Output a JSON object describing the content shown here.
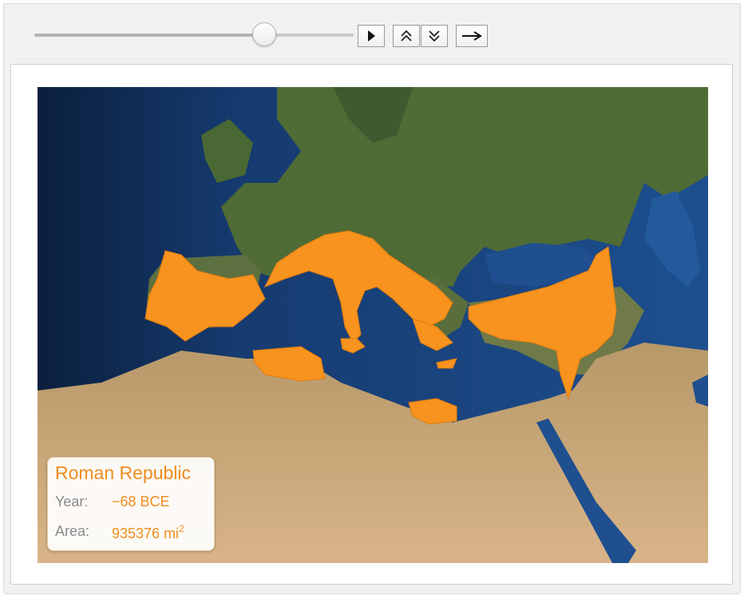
{
  "controls": {
    "slider_value": 0.72,
    "play_icon": "play-icon",
    "faster_icon": "double-chevron-up-icon",
    "slower_icon": "double-chevron-down-icon",
    "direction_icon": "arrow-right-icon"
  },
  "map": {
    "empire_color": "#f7931e",
    "sea_color": "#1f4f8c",
    "land_color": "#4d6b34",
    "desert_color": "#c9a06a"
  },
  "info": {
    "title": "Roman Republic",
    "year_label": "Year:",
    "year_value": "−68 BCE",
    "area_label": "Area:",
    "area_value": "935376 mi",
    "area_unit_exponent": "2"
  }
}
